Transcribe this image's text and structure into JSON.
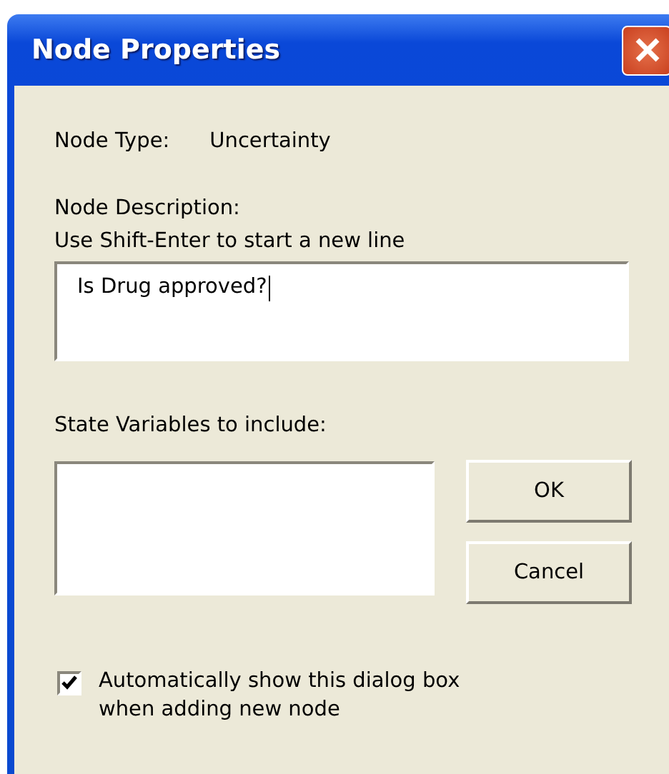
{
  "window": {
    "title": "Node Properties"
  },
  "node_type": {
    "label": "Node Type:",
    "value": "Uncertainty"
  },
  "description": {
    "label": "Node Description:",
    "hint": "Use Shift-Enter to start a new line",
    "value": "Is Drug approved?",
    "focused": true
  },
  "state_variables": {
    "label": "State Variables to include:"
  },
  "buttons": [
    {
      "label": "OK"
    },
    {
      "label": "Cancel"
    }
  ],
  "auto_show": {
    "label": "Automatically show this dialog box when adding new node",
    "checked": true
  }
}
